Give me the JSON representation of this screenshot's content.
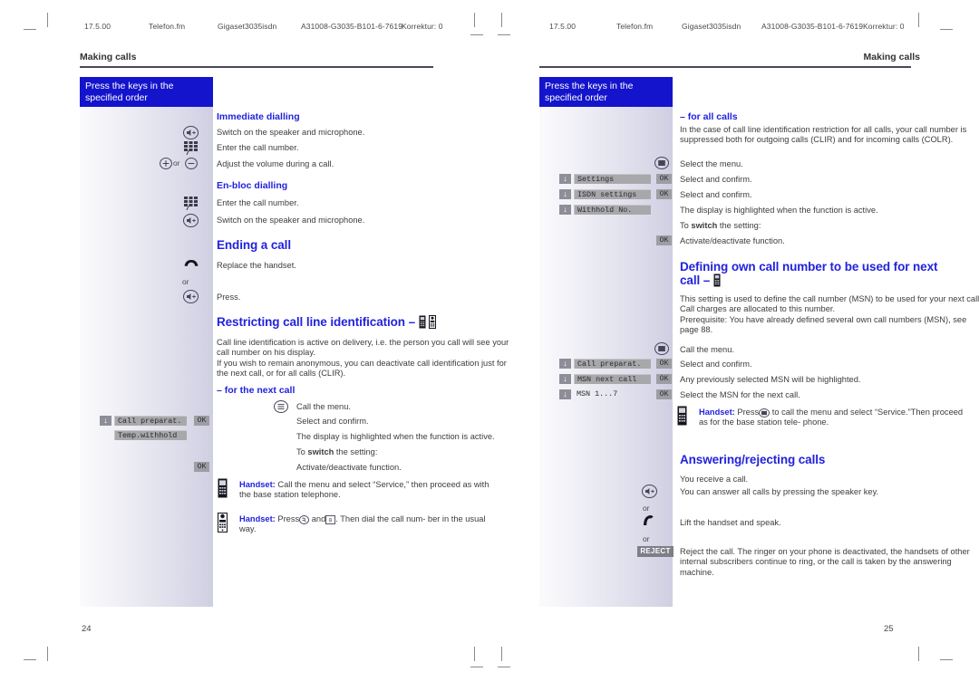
{
  "print_header": {
    "left": [
      "17.5.00",
      "Telefon.fm",
      "Gigaset3035isdn",
      "A31008-G3035-B101-6-7619",
      "Korrektur: 0"
    ],
    "right": [
      "17.5.00",
      "Telefon.fm",
      "Gigaset3035isdn",
      "A31008-G3035-B101-6-7619",
      "Korrektur: 0"
    ]
  },
  "left_page": {
    "running_head": "Making calls",
    "page_number": "24",
    "key_bar": "Press the keys in the\nspecified order",
    "sections": {
      "immediate_dialling": {
        "title": "Immediate dialling",
        "steps": [
          "Switch on the speaker and microphone.",
          "Enter the call number.",
          "Adjust the volume during a call."
        ]
      },
      "en_bloc_dialling": {
        "title": "En-bloc dialling",
        "steps": [
          "Enter the call number.",
          "Switch on the speaker and microphone."
        ]
      },
      "ending_a_call": {
        "title": "Ending a call",
        "steps": [
          "Replace the handset.",
          "Press."
        ],
        "or_label": "or"
      },
      "restricting_clir": {
        "title": "Restricting call line identification –",
        "intro": "Call line identification is active on delivery, i.e. the person you call will see your call number on his display.\nIf you wish to remain anonymous, you can deactivate call identification just for the next call, or for all calls (CLIR).",
        "sub_title": "– for the next call",
        "steps": [
          "Call the menu.",
          "Select and confirm.",
          "The display is highlighted when the function is active.",
          "Activate/deactivate function."
        ],
        "switch_line_pre": "To ",
        "switch_line_bold": "switch",
        "switch_line_post": " the setting:",
        "display_items": [
          {
            "text": "Call preparat.",
            "arrow": true,
            "ok": "OK"
          },
          {
            "text": "Temp.withhold",
            "arrow": false,
            "ok": ""
          }
        ],
        "ok_activate": "OK",
        "notes": [
          {
            "label": "Handset:",
            "text": "Call the menu and select “Service,” then proceed as with the base station telephone."
          },
          {
            "label": "Handset:",
            "text": "Press ⓘ and ⓿. Then dial the call number in the usual way.",
            "text_a": "Press",
            "text_b": "and",
            "text_c": ". Then dial the call num-",
            "text_d": "ber in the usual way."
          }
        ]
      }
    }
  },
  "right_page": {
    "running_head": "Making calls",
    "page_number": "25",
    "key_bar": "Press the keys in the\nspecified order",
    "sections": {
      "for_all_calls": {
        "title": "– for all calls",
        "intro": "In the case of call line identification restriction for all calls, your call number is suppressed both for outgoing calls (CLIR) and for incoming calls (COLR).",
        "steps": [
          "Select the menu.",
          "Select and confirm.",
          "Select and confirm.",
          "The display is highlighted when the function is active.",
          "Activate/deactivate function."
        ],
        "switch_line_pre": "To ",
        "switch_line_bold": "switch",
        "switch_line_post": " the setting:",
        "display_items": [
          {
            "text": "Settings",
            "arrow": true,
            "ok": "OK"
          },
          {
            "text": "ISDN settings",
            "arrow": true,
            "ok": "OK"
          },
          {
            "text": "Withhold No.",
            "arrow": true,
            "ok": ""
          }
        ],
        "ok_activate": "OK"
      },
      "defining_msn": {
        "title_line1": "Defining own call number to be used for next",
        "title_line2": "call –",
        "intro": "This setting is used to define the call number (MSN) to be used for your next call. Call charges are allocated to this number.\nPrerequisite: You have already defined several own call numbers (MSN), see page 88.",
        "steps": [
          "Call the menu.",
          "Select and confirm.",
          "Any previously selected MSN will be highlighted.",
          "Select the MSN for the next call."
        ],
        "display_items": [
          {
            "text": "Call preparat.",
            "arrow": true,
            "ok": "OK",
            "highlight": true
          },
          {
            "text": "MSN next call",
            "arrow": true,
            "ok": "OK",
            "highlight": true
          },
          {
            "text": "MSN 1...7",
            "arrow": true,
            "ok": "OK",
            "highlight": false
          }
        ],
        "note": {
          "label": "Handset:",
          "line1_a": "Press",
          "line1_b": "to call the menu and select",
          "line2": "“Service.”Then proceed as for the base station tele-",
          "line3": "phone."
        }
      },
      "answering_rejecting": {
        "title": "Answering/rejecting calls",
        "steps": [
          "You receive a call.",
          "You can answer all calls by pressing the speaker key.",
          "Lift the handset and speak.",
          "Reject the call. The ringer on your phone is deactivated, the handsets of other internal subscribers continue to ring, or the call is taken by the answering machine."
        ],
        "or_label": "or",
        "reject_key": "REJECT"
      }
    }
  },
  "icons": {
    "speaker_key": "speaker-key-icon",
    "keypad": "keypad-icon",
    "plus_key": "plus-key-icon",
    "minus_key": "minus-key-icon",
    "handset_cradle": "handset-cradle-icon",
    "menu_key": "menu-key-icon",
    "handset_device": "handset-device-icon",
    "base_device": "base-device-icon",
    "down_arrow": "down-arrow-icon"
  },
  "colors": {
    "accent_blue": "#2222dd",
    "bar_blue": "#1414cc",
    "lcd_gray": "#a8a8ac",
    "key_gray": "#9d9da4"
  }
}
